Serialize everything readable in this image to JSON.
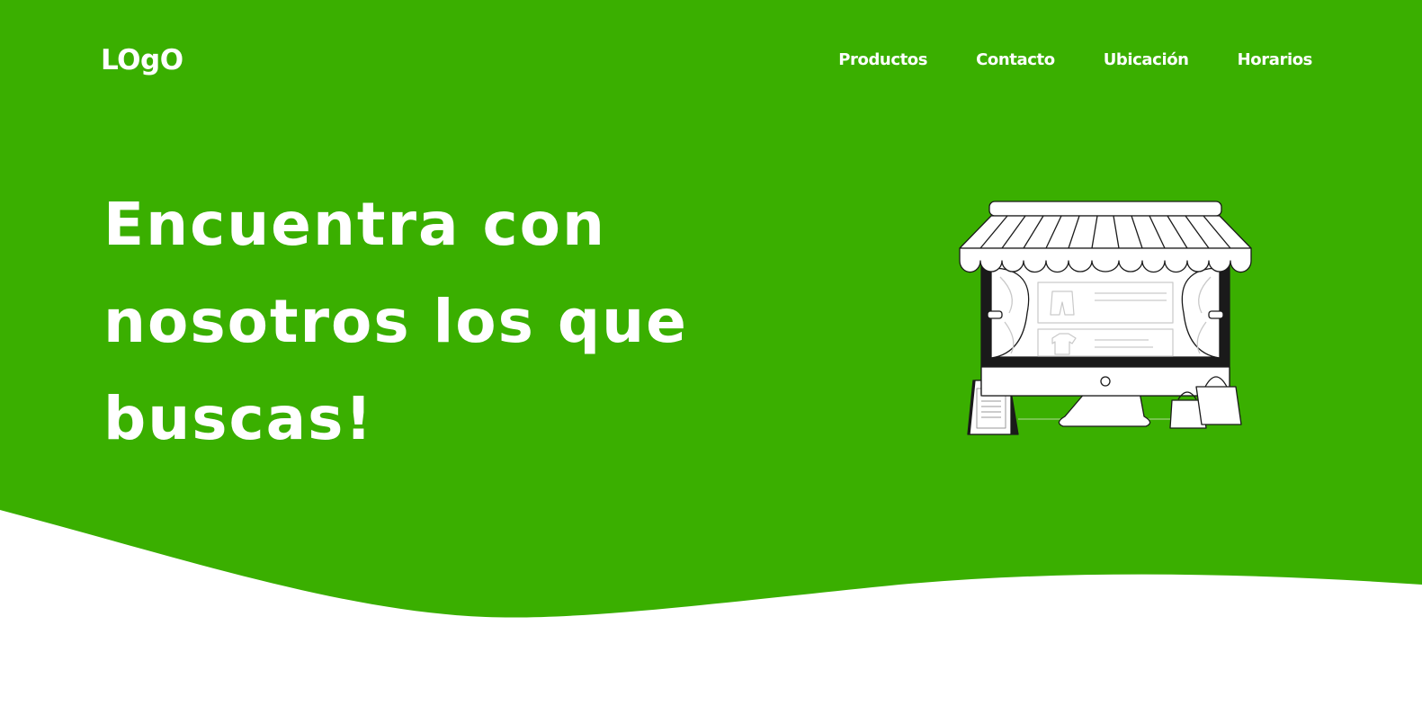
{
  "header": {
    "logo": "LOgO",
    "nav": [
      {
        "label": "Productos"
      },
      {
        "label": "Contacto"
      },
      {
        "label": "Ubicación"
      },
      {
        "label": "Horarios"
      }
    ]
  },
  "hero": {
    "headline": "Encuentra con nosotros los que buscas!",
    "illustration_icon": "storefront-illustration"
  },
  "colors": {
    "brand_green": "#3aaf00",
    "text": "#ffffff",
    "background": "#ffffff"
  }
}
